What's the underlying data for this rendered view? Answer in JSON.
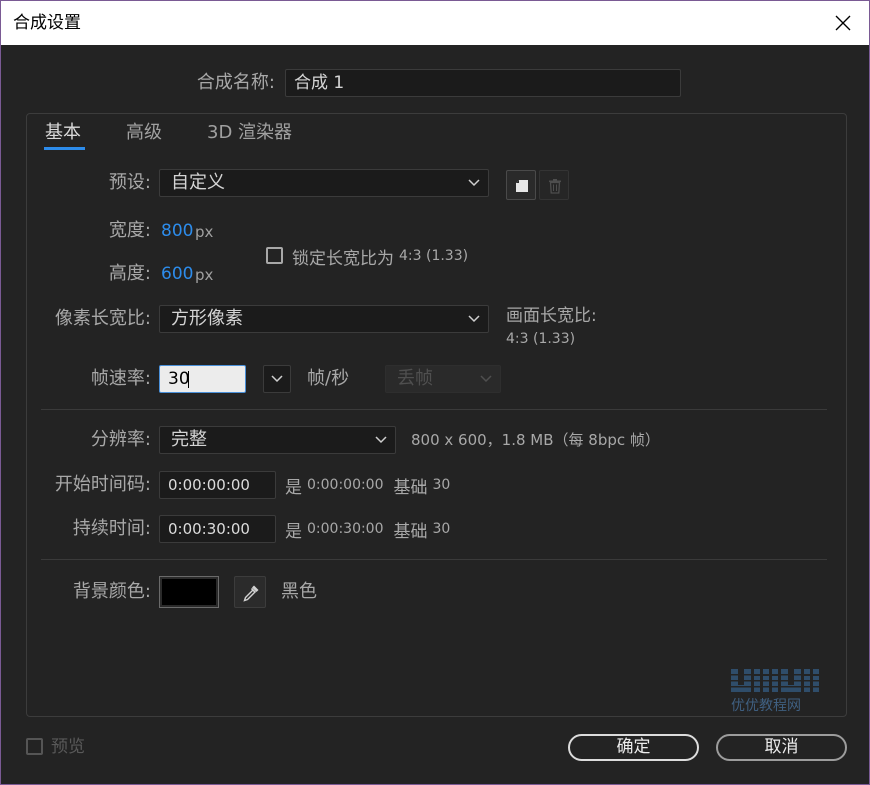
{
  "window": {
    "title": "合成设置"
  },
  "comp_name": {
    "label": "合成名称:",
    "value": "合成 1"
  },
  "tabs": [
    {
      "label": "基本",
      "active": true
    },
    {
      "label": "高级",
      "active": false
    },
    {
      "label": "3D 渲染器",
      "active": false
    }
  ],
  "preset": {
    "label": "预设:",
    "value": "自定义"
  },
  "width": {
    "label": "宽度:",
    "value": "800",
    "unit": "px"
  },
  "height": {
    "label": "高度:",
    "value": "600",
    "unit": "px"
  },
  "lock_aspect": {
    "label": "锁定长宽比为",
    "ratio": "4:3 (1.33)",
    "checked": false
  },
  "pixel_aspect": {
    "label": "像素长宽比:",
    "value": "方形像素"
  },
  "frame_aspect": {
    "label": "画面长宽比:",
    "value": "4:3 (1.33)"
  },
  "frame_rate": {
    "label": "帧速率:",
    "value": "30",
    "unit": "帧/秒",
    "drop_frame": "丢帧"
  },
  "resolution": {
    "label": "分辨率:",
    "value": "完整",
    "info": "800 x 600，1.8 MB（每 8bpc 帧）"
  },
  "start_timecode": {
    "label": "开始时间码:",
    "value": "0:00:00:00",
    "is": "是",
    "equiv": "0:00:00:00",
    "base_label": "基础",
    "base": "30"
  },
  "duration": {
    "label": "持续时间:",
    "value": "0:00:30:00",
    "is": "是",
    "equiv": "0:00:30:00",
    "base_label": "基础",
    "base": "30"
  },
  "background": {
    "label": "背景颜色:",
    "color": "#000000",
    "name": "黑色"
  },
  "preview": {
    "label": "预览",
    "checked": false
  },
  "buttons": {
    "ok": "确定",
    "cancel": "取消"
  },
  "watermark": {
    "text": "优优教程网"
  },
  "colors": {
    "accent": "#2d8ceb",
    "window_border": "#7a5a94"
  },
  "icons": {
    "close": "close-icon",
    "chevron": "chevron-down-icon",
    "save_preset": "save-preset-icon",
    "delete_preset": "trash-icon",
    "eyedropper": "eyedropper-icon",
    "watermark": "logo"
  }
}
